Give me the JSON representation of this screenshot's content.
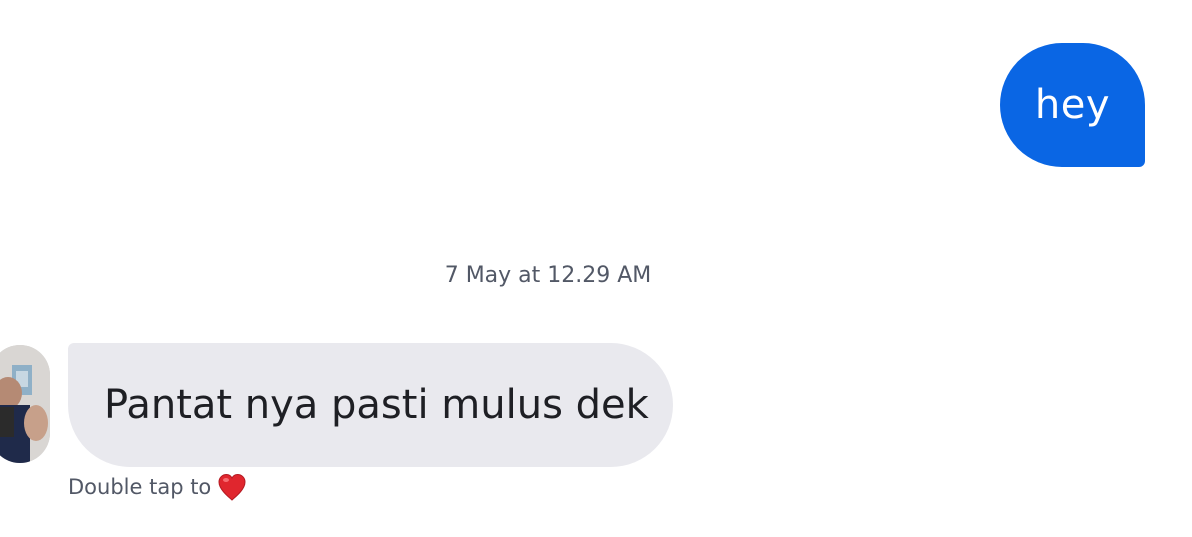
{
  "messages": {
    "sent": {
      "text": "hey"
    },
    "timestamp": "7 May at 12.29 AM",
    "received": {
      "text": "Pantat nya pasti mulus dek",
      "hint": "Double tap to",
      "hint_icon": "heart-icon"
    }
  },
  "colors": {
    "sent_bubble": "#0a66e4",
    "received_bubble": "#e9e9ee",
    "meta_text": "#525866",
    "heart": "#e0262e"
  }
}
